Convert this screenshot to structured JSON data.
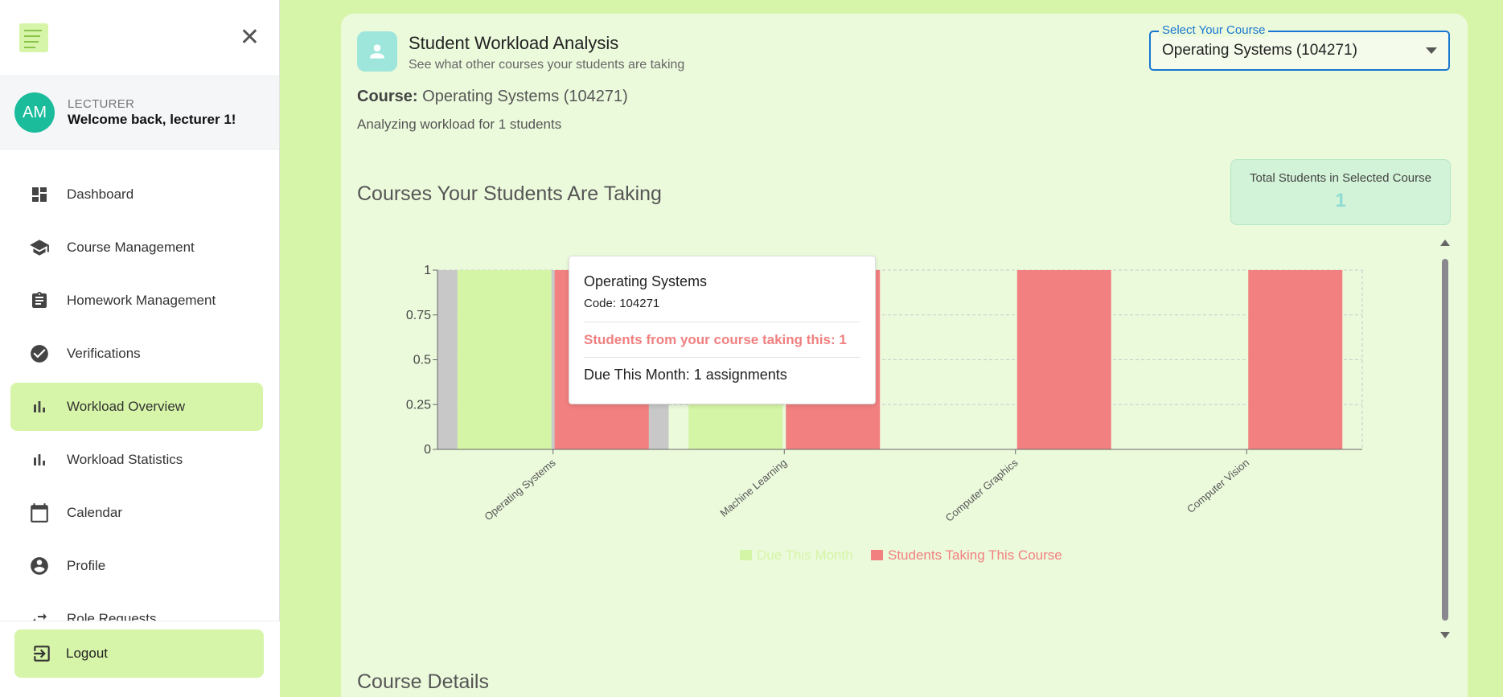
{
  "sidebar": {
    "user": {
      "initials": "AM",
      "role": "LECTURER",
      "welcome": "Welcome back, lecturer 1!"
    },
    "items": [
      {
        "label": "Dashboard",
        "icon": "dashboard-icon"
      },
      {
        "label": "Course Management",
        "icon": "school-icon"
      },
      {
        "label": "Homework Management",
        "icon": "assignment-icon"
      },
      {
        "label": "Verifications",
        "icon": "check-circle-icon"
      },
      {
        "label": "Workload Overview",
        "icon": "bar-chart-icon",
        "active": true
      },
      {
        "label": "Workload Statistics",
        "icon": "bar-chart-icon"
      },
      {
        "label": "Calendar",
        "icon": "calendar-icon"
      },
      {
        "label": "Profile",
        "icon": "account-circle-icon"
      },
      {
        "label": "Role Requests",
        "icon": "swap-icon"
      }
    ],
    "logout": "Logout"
  },
  "header": {
    "title": "Student Workload Analysis",
    "subtitle": "See what other courses your students are taking",
    "select_label": "Select Your Course",
    "select_value": "Operating Systems (104271)"
  },
  "course": {
    "label": "Course:",
    "value": "Operating Systems (104271)",
    "analyzing": "Analyzing workload for 1 students"
  },
  "section_title": "Courses Your Students Are Taking",
  "total": {
    "label": "Total Students in Selected Course",
    "value": "1"
  },
  "tooltip": {
    "name": "Operating Systems",
    "code": "Code: 104271",
    "students": "Students from your course taking this: 1",
    "due": "Due This Month: 1 assignments"
  },
  "details_title": "Course Details",
  "colors": {
    "due": "#d4f5a6",
    "students": "#f28080",
    "accent": "#1976d2",
    "hover": "#c8c8c8"
  },
  "chart_data": {
    "type": "bar",
    "categories": [
      "Operating Systems",
      "Machine Learning",
      "Computer Graphics",
      "Computer Vision"
    ],
    "series": [
      {
        "name": "Due This Month",
        "values": [
          1,
          1,
          0,
          0
        ]
      },
      {
        "name": "Students Taking This Course",
        "values": [
          1,
          1,
          1,
          1
        ]
      }
    ],
    "yticks": [
      "0",
      "0.25",
      "0.5",
      "0.75",
      "1"
    ],
    "ylim": [
      0,
      1
    ],
    "grid": true,
    "legend": "bottom"
  }
}
